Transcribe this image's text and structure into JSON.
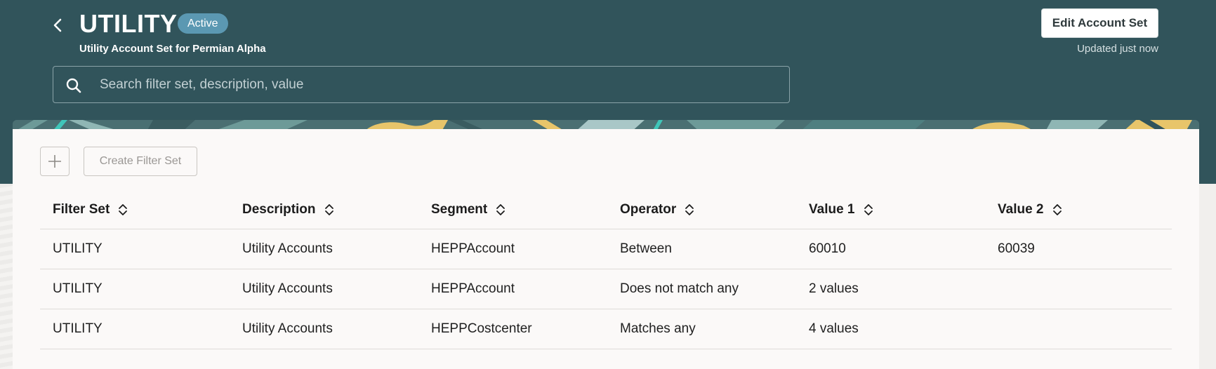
{
  "header": {
    "title": "UTILITY",
    "status": "Active",
    "subtitle": "Utility Account Set for Permian Alpha",
    "edit_label": "Edit Account Set",
    "updated_text": "Updated just now"
  },
  "search": {
    "placeholder": "Search filter set, description, value",
    "value": ""
  },
  "toolbar": {
    "add_icon": "plus-icon",
    "create_label": "Create Filter Set"
  },
  "table": {
    "columns": [
      "Filter Set",
      "Description",
      "Segment",
      "Operator",
      "Value 1",
      "Value 2"
    ],
    "rows": [
      [
        "UTILITY",
        "Utility Accounts",
        "HEPPAccount",
        "Between",
        "60010",
        "60039"
      ],
      [
        "UTILITY",
        "Utility Accounts",
        "HEPPAccount",
        "Does not match any",
        "2 values",
        ""
      ],
      [
        "UTILITY",
        "Utility Accounts",
        "HEPPCostcenter",
        "Matches any",
        "4 values",
        ""
      ]
    ]
  },
  "colors": {
    "header_bg": "#31545b",
    "badge_bg": "#5b98b2",
    "panel_bg": "#fbf9f8"
  }
}
